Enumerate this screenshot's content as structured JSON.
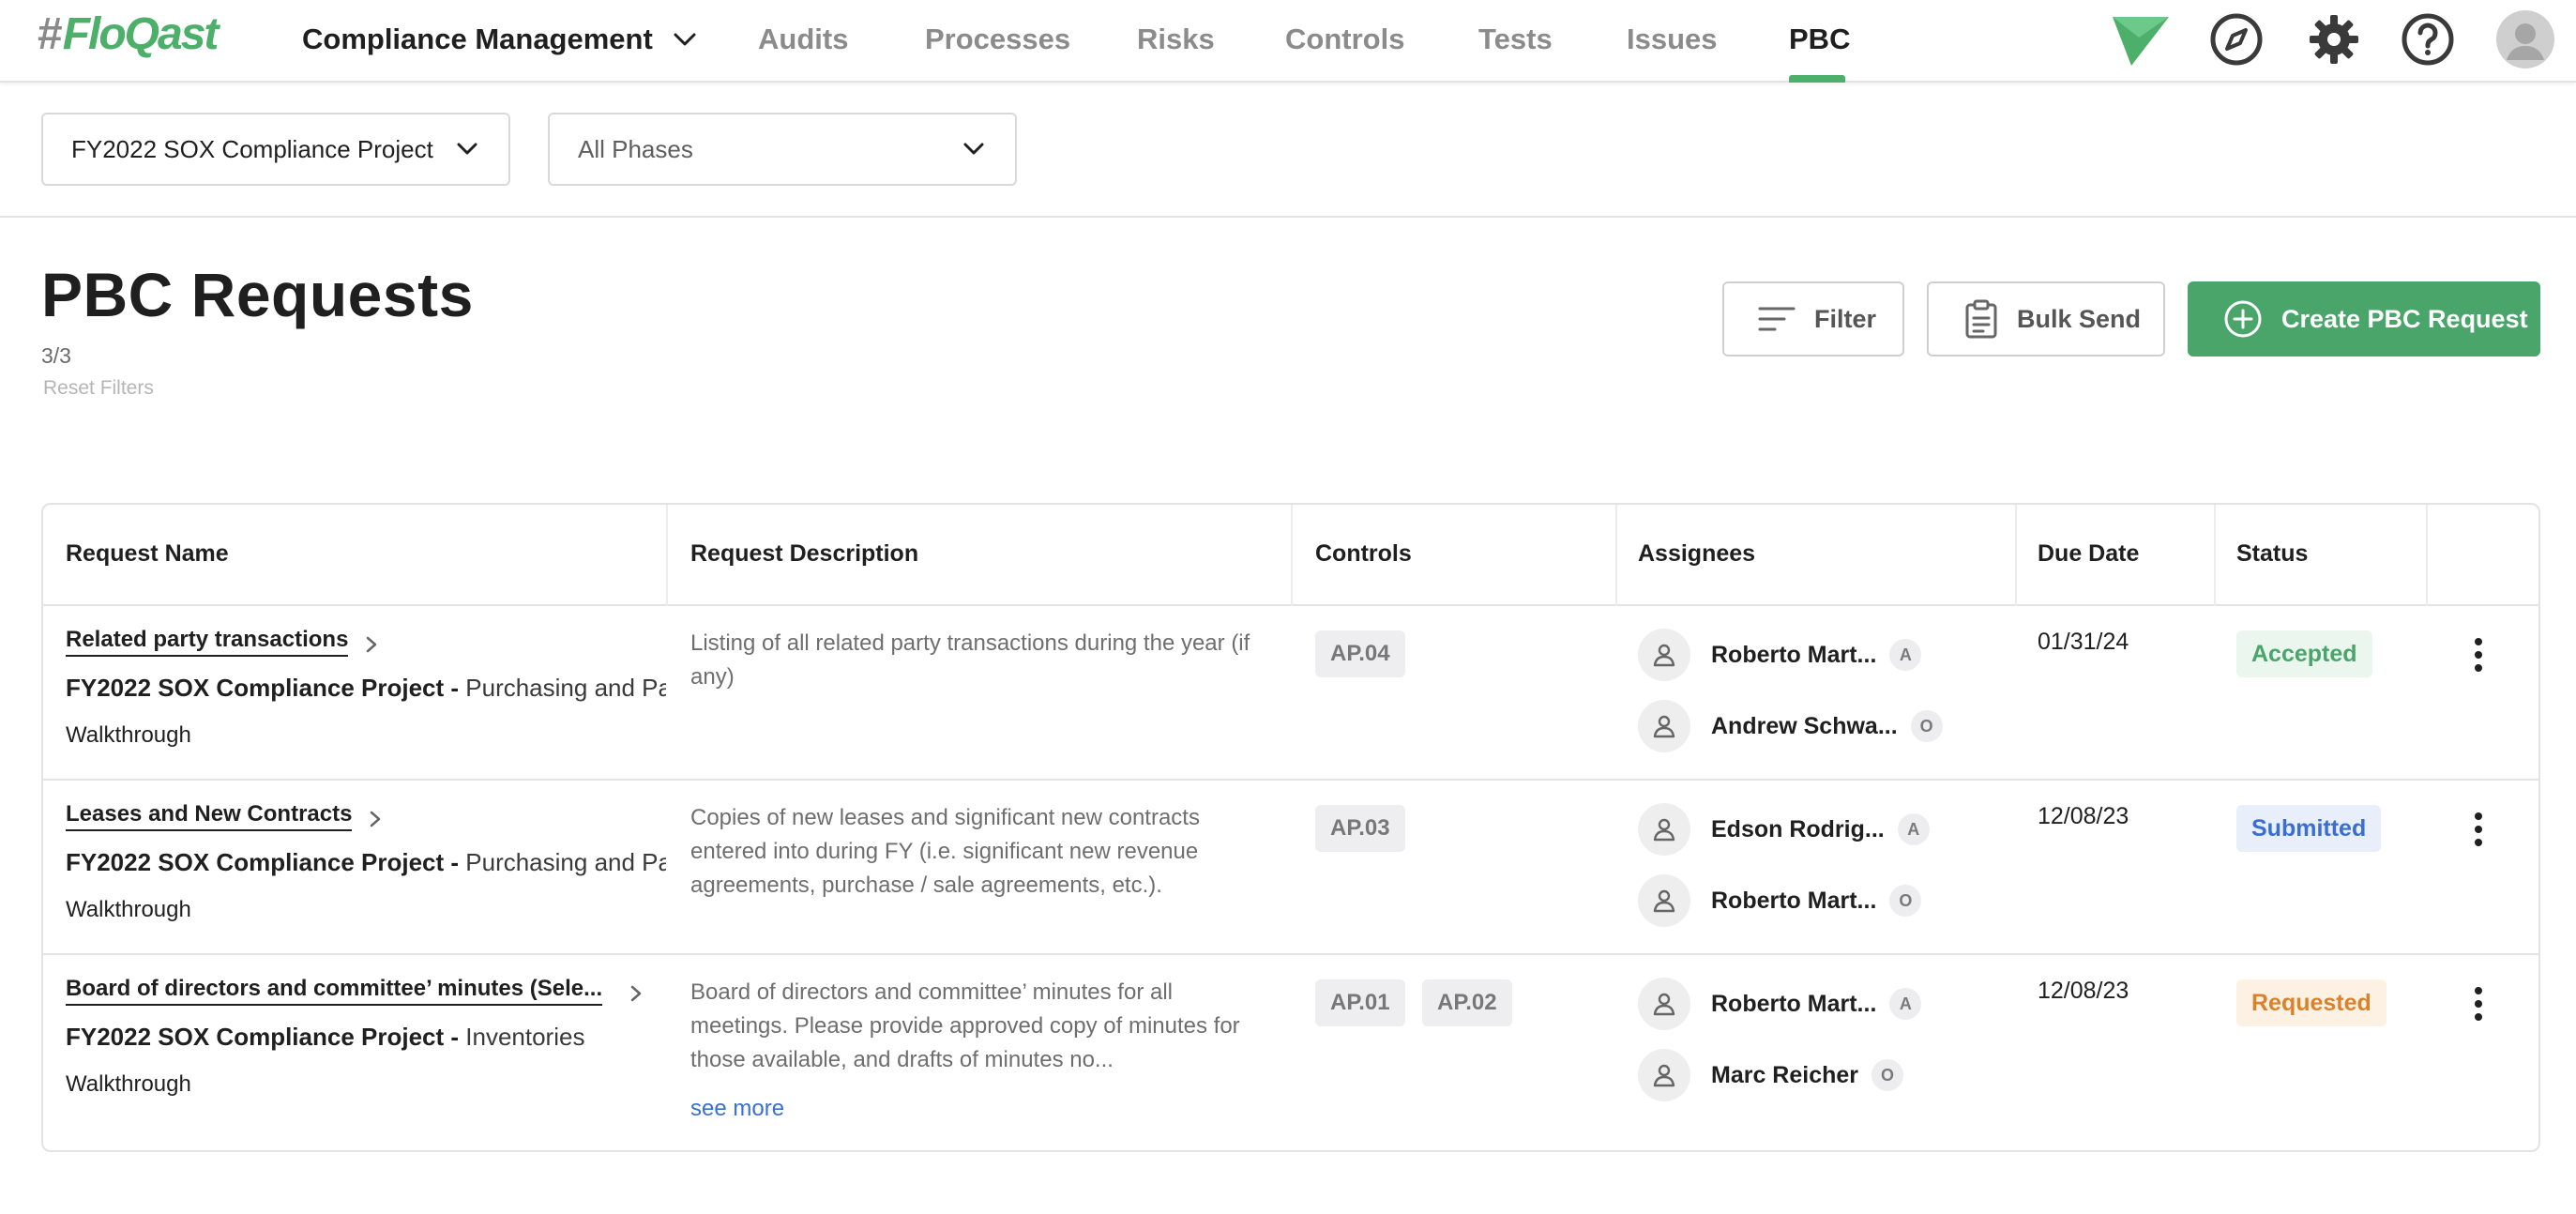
{
  "nav": {
    "logo": "FloQast",
    "logo_hash": "#",
    "module": "Compliance Management",
    "items": [
      {
        "label": "Audits"
      },
      {
        "label": "Processes"
      },
      {
        "label": "Risks"
      },
      {
        "label": "Controls"
      },
      {
        "label": "Tests"
      },
      {
        "label": "Issues"
      },
      {
        "label": "PBC"
      }
    ],
    "active": "PBC",
    "icons": [
      "brand-mark-icon",
      "compass-icon",
      "gear-icon",
      "help-icon",
      "user-avatar-icon"
    ]
  },
  "filters": {
    "project": "FY2022 SOX Compliance Project",
    "phase": "All Phases"
  },
  "page": {
    "title": "PBC Requests",
    "count": "3/3",
    "reset_label": "Reset Filters"
  },
  "actions": {
    "filter": "Filter",
    "bulk_send": "Bulk Send",
    "create": "Create PBC Request"
  },
  "table": {
    "headers": {
      "name": "Request Name",
      "description": "Request Description",
      "controls": "Controls",
      "assignees": "Assignees",
      "due": "Due Date",
      "status": "Status"
    },
    "rows": [
      {
        "name": "Related party transactions",
        "project": "FY2022 SOX Compliance Project",
        "process": "Purchasing and Payables",
        "phase": "Walkthrough",
        "description": "Listing of all related party transactions during the year (if any)",
        "controls": [
          "AP.04"
        ],
        "assignees": [
          {
            "name": "Roberto Mart...",
            "role": "A"
          },
          {
            "name": "Andrew Schwa...",
            "role": "O"
          }
        ],
        "due": "01/31/24",
        "status": "Accepted"
      },
      {
        "name": "Leases and New Contracts",
        "project": "FY2022 SOX Compliance Project",
        "process": "Purchasing and Payables",
        "phase": "Walkthrough",
        "description": "Copies of new leases and significant new contracts entered into during FY (i.e. significant new revenue agreements, purchase / sale agreements, etc.).",
        "controls": [
          "AP.03"
        ],
        "assignees": [
          {
            "name": "Edson Rodrig...",
            "role": "A"
          },
          {
            "name": "Roberto Mart...",
            "role": "O"
          }
        ],
        "due": "12/08/23",
        "status": "Submitted"
      },
      {
        "name": "Board of directors and committee’ minutes (Sele...",
        "project": "FY2022 SOX Compliance Project",
        "process": "Inventories",
        "phase": "Walkthrough",
        "description": "Board of directors and committee’ minutes for all meetings. Please provide approved copy of minutes for those available, and drafts of minutes no...",
        "see_more": "see more",
        "controls": [
          "AP.01",
          "AP.02"
        ],
        "assignees": [
          {
            "name": "Roberto Mart...",
            "role": "A"
          },
          {
            "name": "Marc Reicher",
            "role": "O"
          }
        ],
        "due": "12/08/23",
        "status": "Requested"
      }
    ]
  },
  "colors": {
    "brand_green": "#4aa56b",
    "accepted_bg": "#eaf6ee",
    "accepted_fg": "#4aa56b",
    "submitted_bg": "#e8effb",
    "submitted_fg": "#3a6fd1",
    "requested_bg": "#fdf1e4",
    "requested_fg": "#d9822b"
  }
}
